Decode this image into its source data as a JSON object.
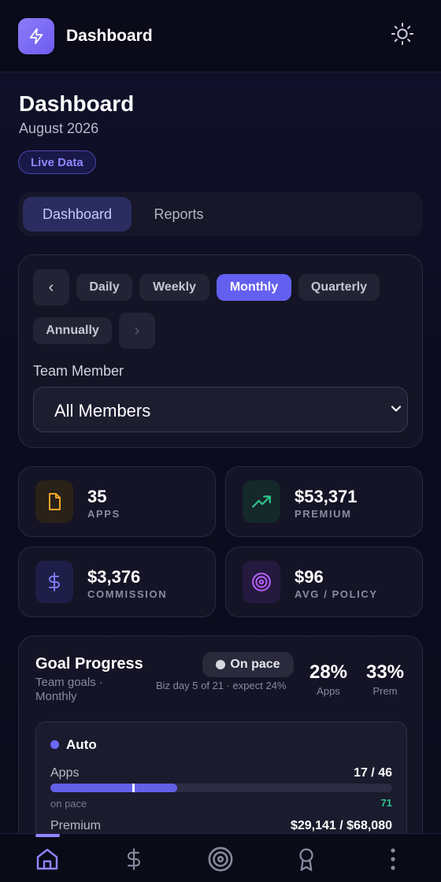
{
  "topbar": {
    "title": "Dashboard",
    "logo_icon": "lightning-bolt-icon",
    "theme_icon": "sun-icon"
  },
  "header": {
    "title": "Dashboard",
    "subtitle": "August 2026",
    "badge": "Live Data"
  },
  "view_tabs": [
    {
      "label": "Dashboard",
      "active": true
    },
    {
      "label": "Reports",
      "active": false
    }
  ],
  "filters": {
    "periods": [
      {
        "label": "Daily",
        "active": false
      },
      {
        "label": "Weekly",
        "active": false
      },
      {
        "label": "Monthly",
        "active": true
      },
      {
        "label": "Quarterly",
        "active": false
      },
      {
        "label": "Annually",
        "active": false
      }
    ],
    "prev_symbol": "‹",
    "next_symbol": "›",
    "member_label": "Team Member",
    "member_value": "All Members"
  },
  "stats": [
    {
      "value": "35",
      "label": "APPS",
      "icon": "document-icon",
      "color": "#f5a524"
    },
    {
      "value": "$53,371",
      "label": "PREMIUM",
      "icon": "trending-up-icon",
      "color": "#2ec78a"
    },
    {
      "value": "$3,376",
      "label": "COMMISSION",
      "icon": "dollar-icon",
      "color": "#7b78f5"
    },
    {
      "value": "$96",
      "label": "AVG / POLICY",
      "icon": "target-icon",
      "color": "#b05cf0"
    }
  ],
  "goal": {
    "title": "Goal Progress",
    "subtitle": "Team goals · Monthly",
    "pace_badge": "On pace",
    "bizday_text": "Biz day 5 of 21 · expect 24%",
    "apps_pct": "28%",
    "apps_pct_label": "Apps",
    "prem_pct": "33%",
    "prem_pct_label": "Prem",
    "auto": {
      "title": "Auto",
      "apps_label": "Apps",
      "apps_value": "17 / 46",
      "apps_progress": 0.37,
      "apps_expected": 0.24,
      "pace_label": "on pace",
      "pace_value": "71",
      "premium_label": "Premium",
      "premium_value": "$29,141 / $68,080"
    }
  },
  "nav": [
    {
      "icon": "home-icon",
      "active": true
    },
    {
      "icon": "dollar-icon",
      "active": false
    },
    {
      "icon": "target-icon",
      "active": false
    },
    {
      "icon": "award-icon",
      "active": false
    },
    {
      "icon": "more-vertical-icon",
      "active": false
    }
  ],
  "colors": {
    "accent": "#6360f0",
    "background": "#0b0b1c",
    "success": "#2ec78a"
  }
}
